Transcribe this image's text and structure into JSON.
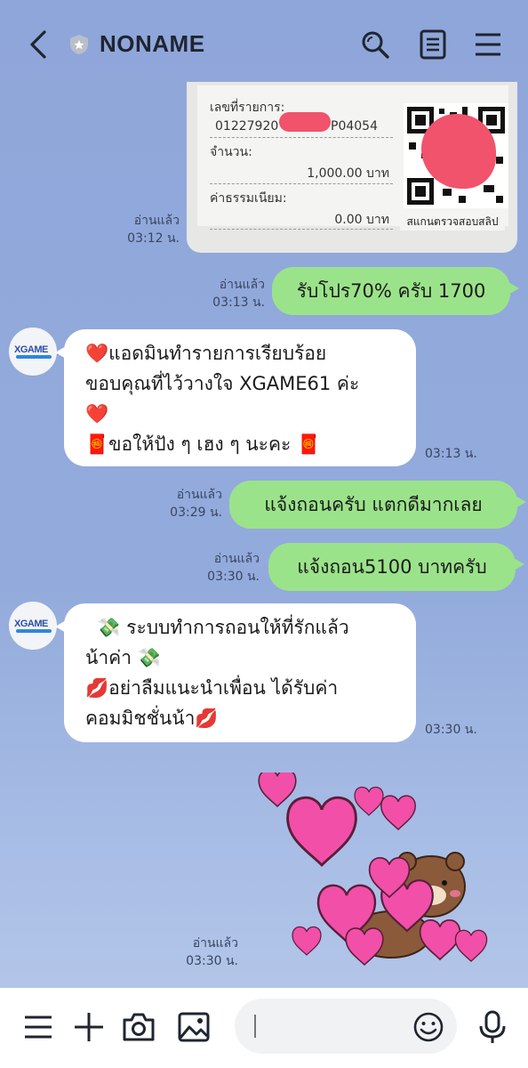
{
  "header": {
    "title": "NONAME"
  },
  "receipt": {
    "ref_label": "เลขที่รายการ:",
    "ref_prefix": "01227920",
    "ref_suffix": "P04054",
    "amount_label": "จำนวน:",
    "amount_value": "1,000.00 บาท",
    "fee_label": "ค่าธรรมเนียม:",
    "fee_value": "0.00 บาท",
    "qr_caption": "สแกนตรวจสอบสลิป",
    "read": "อ่านแล้ว",
    "time": "03:12 น."
  },
  "messages": [
    {
      "side": "out",
      "text": "รับโปร70% ครับ 1700",
      "read": "อ่านแล้ว",
      "time": "03:13 น."
    },
    {
      "side": "in",
      "lines": [
        "❤️แอดมินทำรายการเรียบร้อย",
        "ขอบคุณที่ไว้วางใจ XGAME61 ค่ะ",
        "❤️",
        "🧧ขอให้ปัง ๆ เฮง ๆ นะคะ 🧧"
      ],
      "time": "03:13 น."
    },
    {
      "side": "out",
      "text": "แจ้งถอนครับ แตกดีมากเลย",
      "read": "อ่านแล้ว",
      "time": "03:29 น."
    },
    {
      "side": "out",
      "text": "แจ้งถอน5100 บาทครับ",
      "read": "อ่านแล้ว",
      "time": "03:30 น."
    },
    {
      "side": "in",
      "lines": [
        "  💸 ระบบทำการถอนให้ที่รักแล้ว",
        "น้าค่า 💸",
        "💋อย่าลืมแนะนำเพื่อน ได้รับค่า",
        "คอมมิชชั่นน้า💋"
      ],
      "time": "03:30 น."
    }
  ],
  "avatar": {
    "logo": "XGAME"
  },
  "sticker": {
    "read": "อ่านแล้ว",
    "time": "03:30 น."
  },
  "colors": {
    "accent_green": "#9be38a",
    "background": "#8fa6da",
    "bubble_in": "#ffffff"
  },
  "icons": [
    "back-arrow-icon",
    "shield-icon",
    "search-icon",
    "notes-icon",
    "menu-icon",
    "more-menu-icon",
    "plus-icon",
    "camera-icon",
    "image-icon",
    "emoji-icon",
    "microphone-icon"
  ]
}
